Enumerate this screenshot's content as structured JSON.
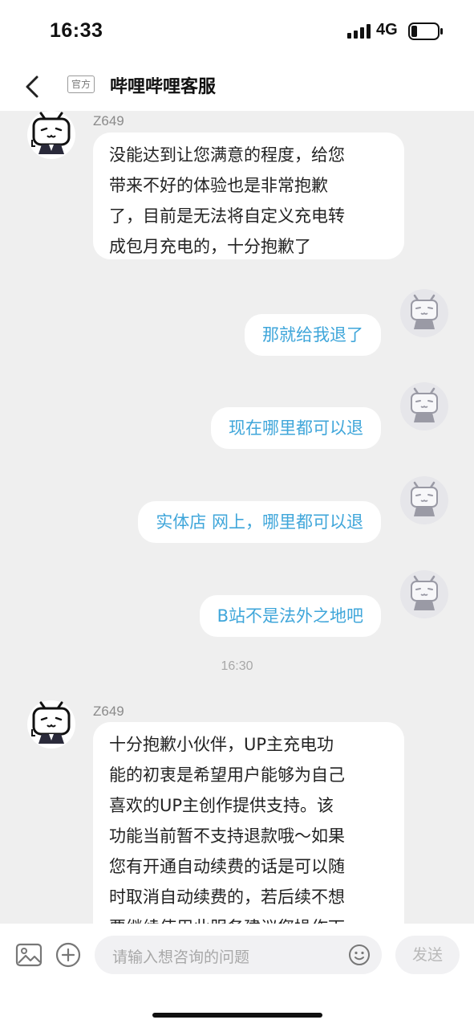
{
  "status_bar": {
    "time": "16:33",
    "network": "4G",
    "icons": [
      "signal-bars-icon",
      "battery-icon"
    ]
  },
  "header": {
    "back_icon": "chevron-left-icon",
    "badge": "官方",
    "title": "哔哩哔哩客服"
  },
  "messages": [
    {
      "side": "left",
      "sender": "Z649",
      "avatar_icon": "bilibili-tv-mascot-icon",
      "lines": [
        "没能达到让您满意的程度，给您",
        "带来不好的体验也是非常抱歉",
        "了，目前是无法将自定义充电转",
        "成包月充电的，十分抱歉了"
      ]
    },
    {
      "side": "right",
      "avatar_icon": "bilibili-tv-mascot-icon",
      "text": "那就给我退了"
    },
    {
      "side": "right",
      "avatar_icon": "bilibili-tv-mascot-icon",
      "text": "现在哪里都可以退"
    },
    {
      "side": "right",
      "avatar_icon": "bilibili-tv-mascot-icon",
      "text": "实体店 网上，哪里都可以退"
    },
    {
      "side": "right",
      "avatar_icon": "bilibili-tv-mascot-icon",
      "text": "B站不是法外之地吧"
    },
    {
      "side": "divider",
      "text": "16:30"
    },
    {
      "side": "left",
      "sender": "Z649",
      "avatar_icon": "bilibili-tv-mascot-icon",
      "lines": [
        "十分抱歉小伙伴，UP主充电功",
        "能的初衷是希望用户能够为自己",
        "喜欢的UP主创作提供支持。该",
        "功能当前暂不支持退款哦～如果",
        "您有开通自动续费的话是可以随",
        "时取消自动续费的，若后续不想",
        "要继续使用此服务建议您操作下"
      ]
    }
  ],
  "input_bar": {
    "image_icon": "image-icon",
    "add_icon": "plus-circle-icon",
    "placeholder": "请输入想咨询的问题",
    "emoji_icon": "emoji-icon",
    "send_label": "发送"
  },
  "colors": {
    "background": "#efefef",
    "user_text": "#3fa6da",
    "agent_text": "#222222",
    "muted": "#8a8a8a"
  }
}
